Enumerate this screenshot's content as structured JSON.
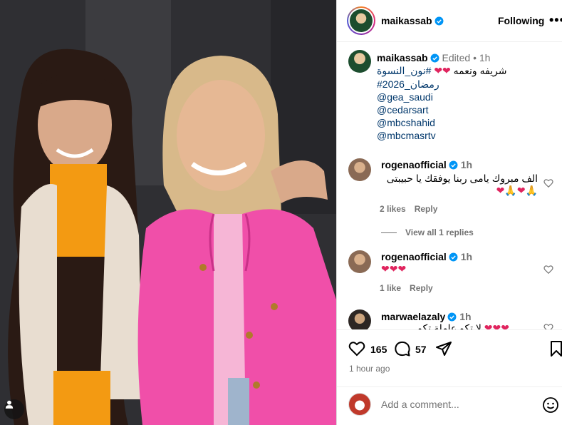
{
  "post": {
    "author": "maikassab",
    "follow_label": "Following",
    "more_label": "•••",
    "caption": {
      "edited_label": "Edited",
      "separator": "•",
      "time": "1h",
      "text_rtl": "شريفه ونعمه",
      "hashtags": [
        "#نون_النسوة",
        "#رمضان_2026"
      ],
      "mentions": [
        "@gea_saudi",
        "@cedarsart",
        "@mbcshahid",
        "@mbcmasrtv"
      ]
    }
  },
  "comments": [
    {
      "user": "rogenaofficial",
      "time": "1h",
      "text": "الف مبروك يامى ربنا يوفقك يا حبيبتى",
      "likes": "2 likes",
      "reply_label": "Reply",
      "view_replies": "View all 1 replies"
    },
    {
      "user": "rogenaofficial",
      "time": "1h",
      "text": "",
      "likes": "1 like",
      "reply_label": "Reply"
    },
    {
      "user": "marwaelazaly",
      "time": "1h",
      "text": "لا تكو عاملة تكو"
    }
  ],
  "footer": {
    "likes_count": "165",
    "comments_count": "57",
    "time_ago": "1 hour ago",
    "add_comment_placeholder": "Add a comment..."
  },
  "icons": {
    "verified": "verified-badge-icon",
    "heart": "heart-icon",
    "comment": "comment-icon",
    "share": "share-icon",
    "save": "bookmark-icon",
    "emoji": "emoji-icon",
    "tag": "user-tag-icon"
  },
  "colors": {
    "verified_blue": "#0095f6",
    "link_blue": "#00376b",
    "muted_gray": "#737373",
    "heart_red": "#e0245e"
  }
}
